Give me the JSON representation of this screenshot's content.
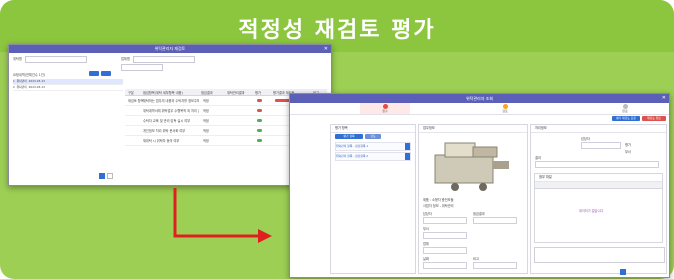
{
  "banner": {
    "title": "적정성 재검토 평가"
  },
  "winA": {
    "title": "위탁관리자 재검토",
    "search_labels": [
      "위탁명",
      "업체명"
    ],
    "list_header": "요청내역(전체건수 1건)",
    "list_items": [
      {
        "no": "1",
        "name": "위탁관리",
        "date": "2023-03-13"
      },
      {
        "no": "2",
        "name": "위탁관리",
        "date": "2023-03-13"
      }
    ],
    "grid_columns": [
      "구분",
      "점검항목(위탁 세부항목 내용)",
      "점검결과",
      "위탁관리결과",
      "평가",
      "평가결과 재검토",
      "비고"
    ],
    "grid_rows": [
      {
        "cat": "재검토 항목",
        "item": "위탁하는 업무의 내용과 수탁자를 정보주체에게 알리고 있는가",
        "res": "적정"
      },
      {
        "cat": "",
        "item": "위탁계약서에 위탁업무 수행목적 외 처리 금지 등 포함",
        "res": "적정"
      },
      {
        "cat": "",
        "item": "수탁자 교육 및 관리·감독 실시 여부",
        "res": "적정"
      },
      {
        "cat": "",
        "item": "개인정보 처리 위탁 문서화 여부",
        "res": "적정"
      },
      {
        "cat": "",
        "item": "재위탁 시 위탁자 동의 여부",
        "res": "적정"
      }
    ],
    "pager": [
      "1",
      "2",
      "3"
    ]
  },
  "winB": {
    "title": "위탁관리자 조회",
    "steps": [
      "접수",
      "검토",
      "완료"
    ],
    "top_buttons": [
      "평가 재검토 요청",
      "재검토 완료"
    ],
    "left_panel_title": "평가 항목",
    "tabs": [
      "평가 항목",
      "검토"
    ],
    "side_items": [
      "위탁관리 항목 - 점검항목 1",
      "위탁관리 항목 - 점검항목 2"
    ],
    "mid_panel_title": "업무정보",
    "product_title": "제품 : 소형차 충전모듈",
    "product_sub": "사업자 정보 - 위탁관리",
    "fields": [
      "담당자",
      "점검결과",
      "부서",
      "업체",
      "날짜",
      "비고"
    ],
    "right_panel_title": "처리정보",
    "right_fields": [
      "담당자",
      "평가",
      "부서",
      "결과"
    ],
    "sub_panel_title": "첨부 파일",
    "empty_text": "데이터가 없습니다"
  },
  "colors": {
    "banner": "#8cc63f",
    "window_bar": "#5b5fb8",
    "accent_blue": "#2f6fd6",
    "arrow": "#e02020"
  }
}
